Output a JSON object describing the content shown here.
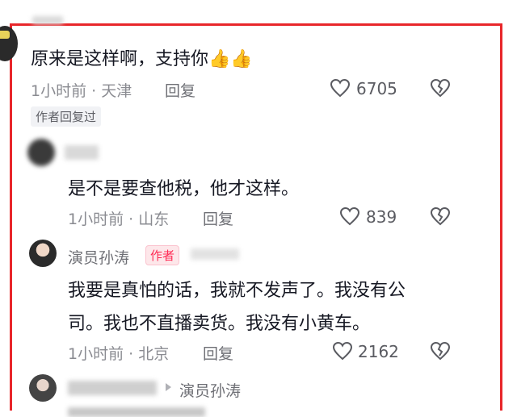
{
  "comments": [
    {
      "text": "原来是这样啊，支持你👍👍",
      "time_location": "1小时前 · 天津",
      "reply_label": "回复",
      "likes": "6705",
      "tag": "作者回复过"
    },
    {
      "text": "是不是要查他税，他才这样。",
      "time_location": "1小时前 · 山东",
      "reply_label": "回复",
      "likes": "839"
    },
    {
      "username": "演员孙涛",
      "badge": "作者",
      "text_line1": "我要是真怕的话，我就不发声了。我没有公",
      "text_line2": "司。我也不直播卖货。我没有小黄车。",
      "time_location": "1小时前 · 北京",
      "reply_label": "回复",
      "likes": "2162"
    },
    {
      "reply_to": "演员孙涛"
    }
  ],
  "colors": {
    "frame": "#e8262a",
    "badge": "#fe2c55"
  }
}
